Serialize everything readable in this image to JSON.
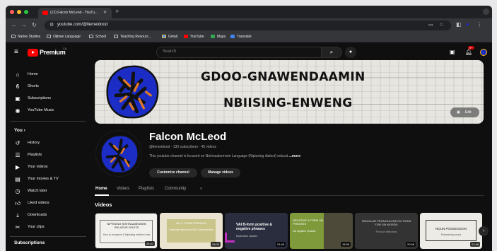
{
  "browser": {
    "tab_title": "(13) Falcon McLeod - YouTu...",
    "url": "youtube.com/@llemeidood",
    "bookmarks": [
      "Native Studies",
      "Ojibwe Language",
      "School",
      "Teaching Resourc...",
      "Gmail",
      "YouTube",
      "Maps",
      "Translate"
    ]
  },
  "header": {
    "logo_text": "Premium",
    "country": "CA",
    "search_placeholder": "Search",
    "notification_count": "9+"
  },
  "sidebar": {
    "items": [
      {
        "label": "Home",
        "icon": "home-icon"
      },
      {
        "label": "Shorts",
        "icon": "shorts-icon"
      },
      {
        "label": "Subscriptions",
        "icon": "subscriptions-icon"
      },
      {
        "label": "YouTube Music",
        "icon": "music-icon"
      }
    ],
    "you_heading": "You",
    "you_items": [
      {
        "label": "History",
        "icon": "history-icon"
      },
      {
        "label": "Playlists",
        "icon": "playlists-icon"
      },
      {
        "label": "Your videos",
        "icon": "your-videos-icon"
      },
      {
        "label": "Your movies & TV",
        "icon": "movies-icon"
      },
      {
        "label": "Watch later",
        "icon": "watch-later-icon"
      },
      {
        "label": "Liked videos",
        "icon": "liked-icon"
      },
      {
        "label": "Downloads",
        "icon": "download-icon"
      },
      {
        "label": "Your clips",
        "icon": "clips-icon"
      }
    ],
    "subscriptions_heading": "Subscriptions"
  },
  "banner": {
    "line1": "GDOO-GNAWENDAAMIN",
    "line2": "NBIISING-ENWENG",
    "edit_label": "Edit"
  },
  "channel": {
    "name": "Falcon McLeod",
    "meta": "@llemeidood · 130 subscribers · 45 videos",
    "description": "This youtube channel is focused on Nishnaabemwin Language (Nipissing dialect) educat",
    "more": "...more",
    "customize_label": "Customize channel",
    "manage_label": "Manage videos"
  },
  "tabs": [
    "Home",
    "Videos",
    "Playlists",
    "Community"
  ],
  "videos": {
    "heading": "Videos",
    "items": [
      {
        "title": "NIPISSING NISHNAABEMWIN RELATIVE ROOTS",
        "sub": "How to recognize & Nipissing relative roots",
        "duration": "24:47"
      },
      {
        "title": "VAI C FORM PHRASES",
        "sub": "Learning how to use Vai C-form phrases",
        "duration": "29:03"
      },
      {
        "title": "VAI B-form positive & negative phrases",
        "sub": "Dependent clauses",
        "duration": "21:49"
      },
      {
        "title": "NEGATIVE A FORM VAI PHRASES",
        "sub": "Vai negative phrases",
        "duration": "15:36"
      },
      {
        "title": "SINGULAR PRONOUN INFLECTIONS FOR VAI WORDS",
        "sub": "Pronoun inflections",
        "duration": "20:36"
      },
      {
        "title": "NOUN POSSESSION",
        "sub": "Possessing nouns",
        "duration": "21:48"
      }
    ]
  },
  "colors": {
    "background": "#0f0f0f",
    "brand_red": "#ff0000",
    "art_blue": "#1b2dc4",
    "art_orange": "#e0782a"
  }
}
